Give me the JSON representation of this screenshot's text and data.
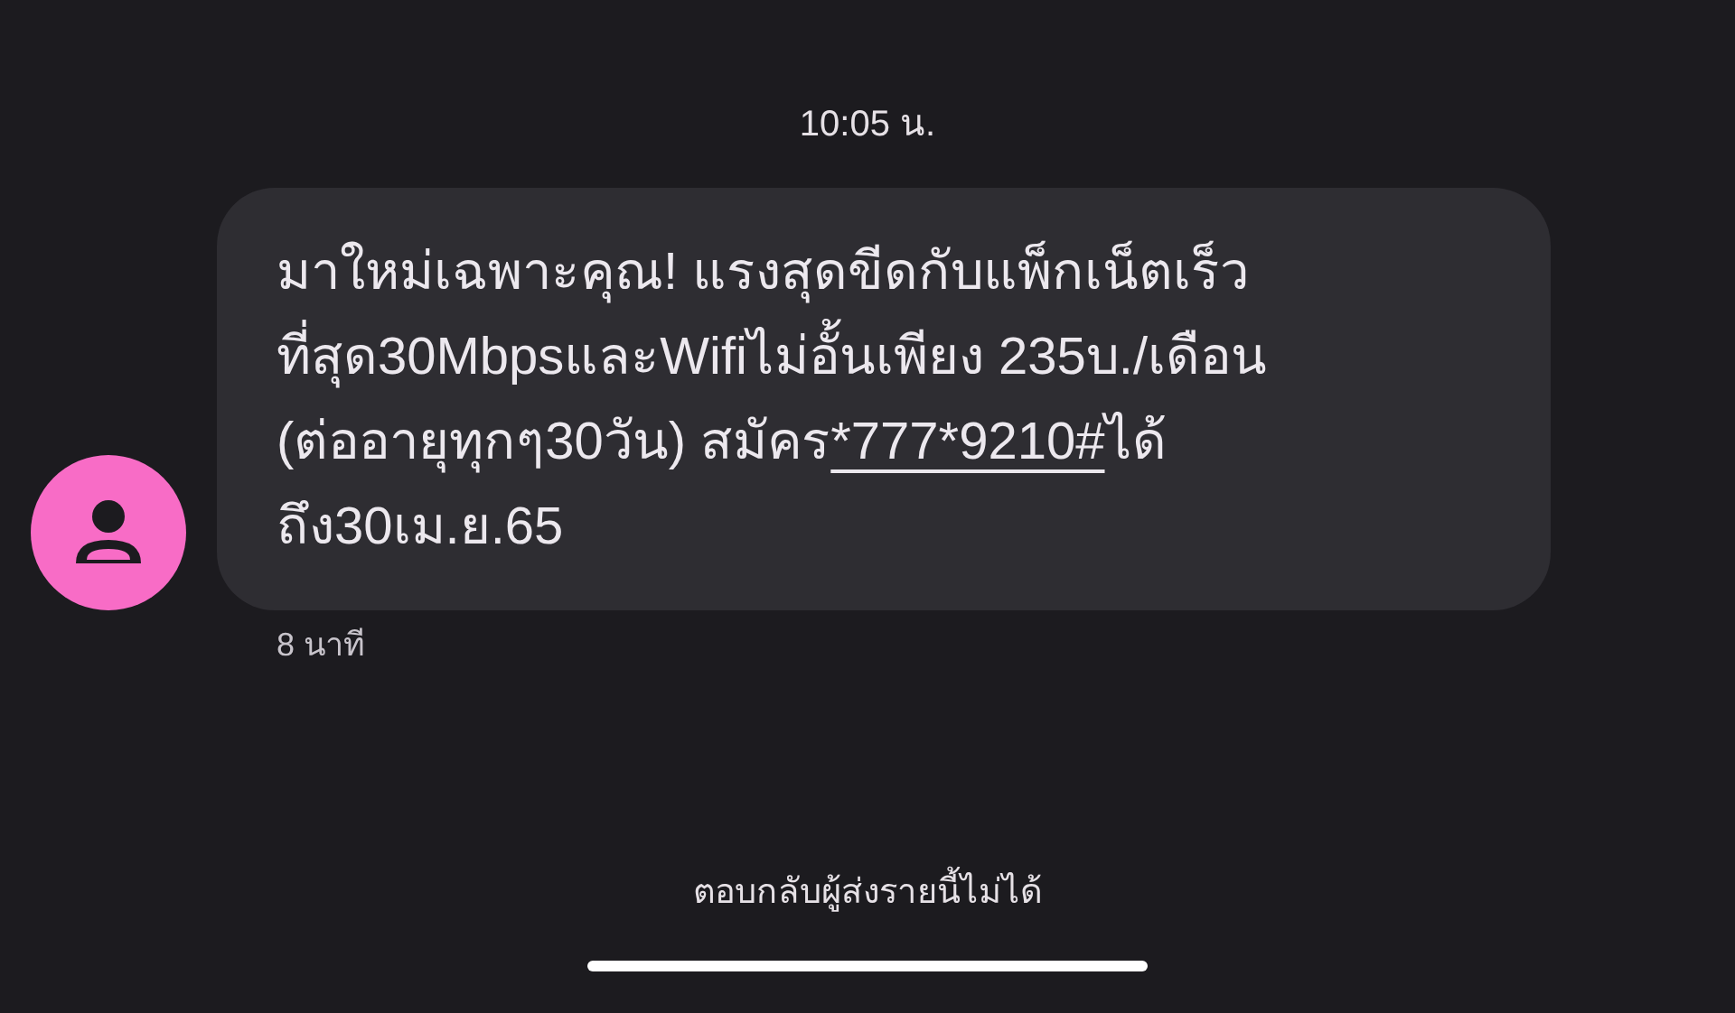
{
  "timestamp": "10:05 น.",
  "message": {
    "text_before_link": "มาใหม่เฉพาะคุณ! แรงสุดขีดกับแพ็กเน็ตเร็ว\nที่สุด30MbpsและWifiไม่อั้นเพียง 235บ./เดือน\n(ต่ออายุทุกๆ30วัน) สมัคร",
    "link": "*777*9210#",
    "text_after_link": "ได้\nถึง30เม.ย.65",
    "age": "8 นาที"
  },
  "reply_notice": "ตอบกลับผู้ส่งรายนี้ไม่ได้"
}
